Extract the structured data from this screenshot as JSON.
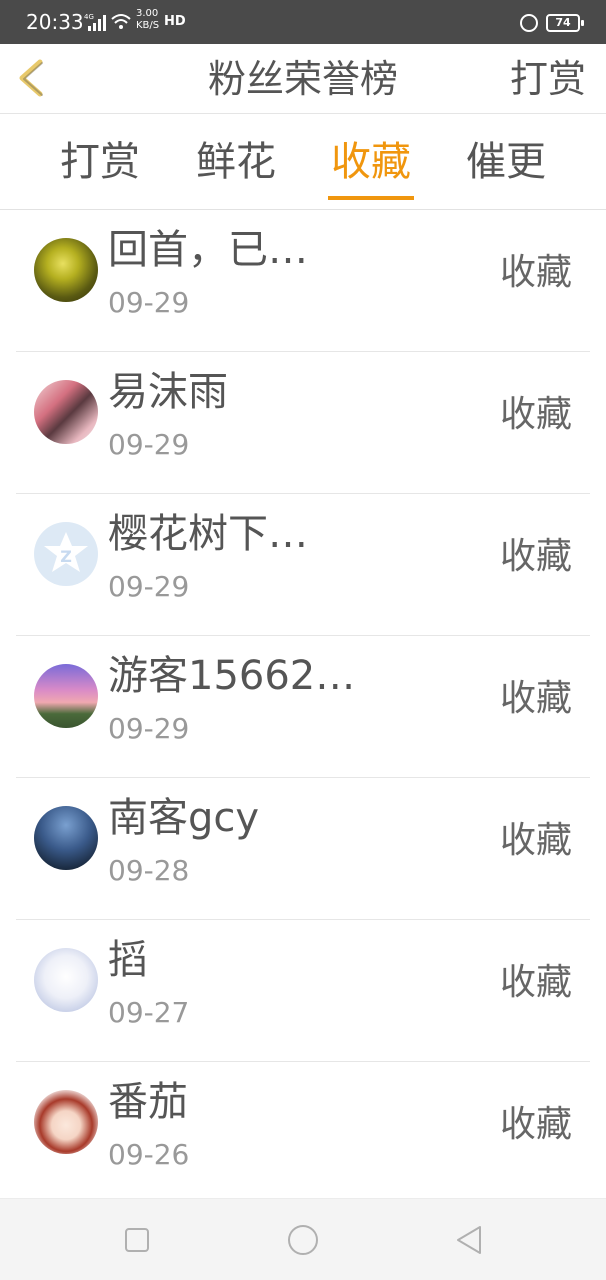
{
  "status_bar": {
    "time": "20:33",
    "network": "4G",
    "speed": "3.00\nKB/S",
    "hd": "HD",
    "battery": "74",
    "icons": [
      "signal-icon",
      "wifi-icon",
      "hd-call-icon",
      "alarm-icon",
      "battery-icon"
    ]
  },
  "header": {
    "back_icon": "chevron-left-icon",
    "title": "粉丝荣誉榜",
    "action_label": "打赏",
    "accent_color": "#f0960e"
  },
  "tabs": [
    {
      "label": "打赏",
      "active": false
    },
    {
      "label": "鲜花",
      "active": false
    },
    {
      "label": "收藏",
      "active": true
    },
    {
      "label": "催更",
      "active": false
    }
  ],
  "list": {
    "items": [
      {
        "name": "回首，已…",
        "date": "09-29",
        "action": "收藏",
        "avatar": "avatar-glowing-forest"
      },
      {
        "name": "易沫雨",
        "date": "09-29",
        "action": "收藏",
        "avatar": "avatar-pink-illustration"
      },
      {
        "name": "樱花树下…",
        "date": "09-29",
        "action": "收藏",
        "avatar": "avatar-default-z"
      },
      {
        "name": "游客15662…",
        "date": "09-29",
        "action": "收藏",
        "avatar": "avatar-sunset-tree"
      },
      {
        "name": "南客gcy",
        "date": "09-28",
        "action": "收藏",
        "avatar": "avatar-wolf-night"
      },
      {
        "name": "搯",
        "date": "09-27",
        "action": "收藏",
        "avatar": "avatar-anime-white-hair"
      },
      {
        "name": "番茄",
        "date": "09-26",
        "action": "收藏",
        "avatar": "avatar-anime-red-hair"
      }
    ]
  },
  "nav_bar": {
    "buttons": [
      "recent-apps-icon",
      "home-icon",
      "back-icon"
    ]
  }
}
